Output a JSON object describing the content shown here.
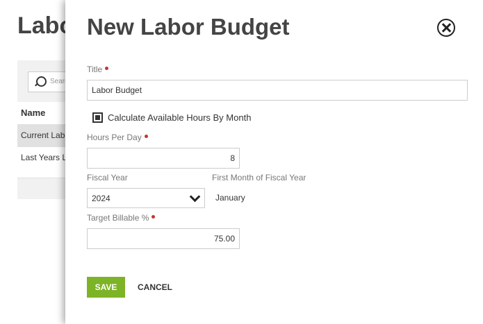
{
  "background": {
    "page_title": "Labo",
    "search_placeholder": "Searc",
    "table": {
      "header": "Name",
      "rows": [
        "Current Lab",
        "Last Years L"
      ]
    }
  },
  "modal": {
    "title": "New Labor Budget",
    "close_icon": "close-circle-icon",
    "title_field": {
      "label": "Title",
      "value": "Labor Budget",
      "required": true
    },
    "calc_checkbox": {
      "label": "Calculate Available Hours By Month",
      "checked": true
    },
    "hours_per_day": {
      "label": "Hours Per Day",
      "value": "8",
      "required": true
    },
    "fiscal_year": {
      "label": "Fiscal Year",
      "value": "2024"
    },
    "first_month": {
      "label": "First Month of Fiscal Year",
      "value": "January"
    },
    "target_billable": {
      "label": "Target Billable %",
      "value": "75.00",
      "required": true
    },
    "save_label": "SAVE",
    "cancel_label": "CANCEL"
  },
  "colors": {
    "accent_green": "#7db326",
    "required_dot": "#c0392b"
  }
}
